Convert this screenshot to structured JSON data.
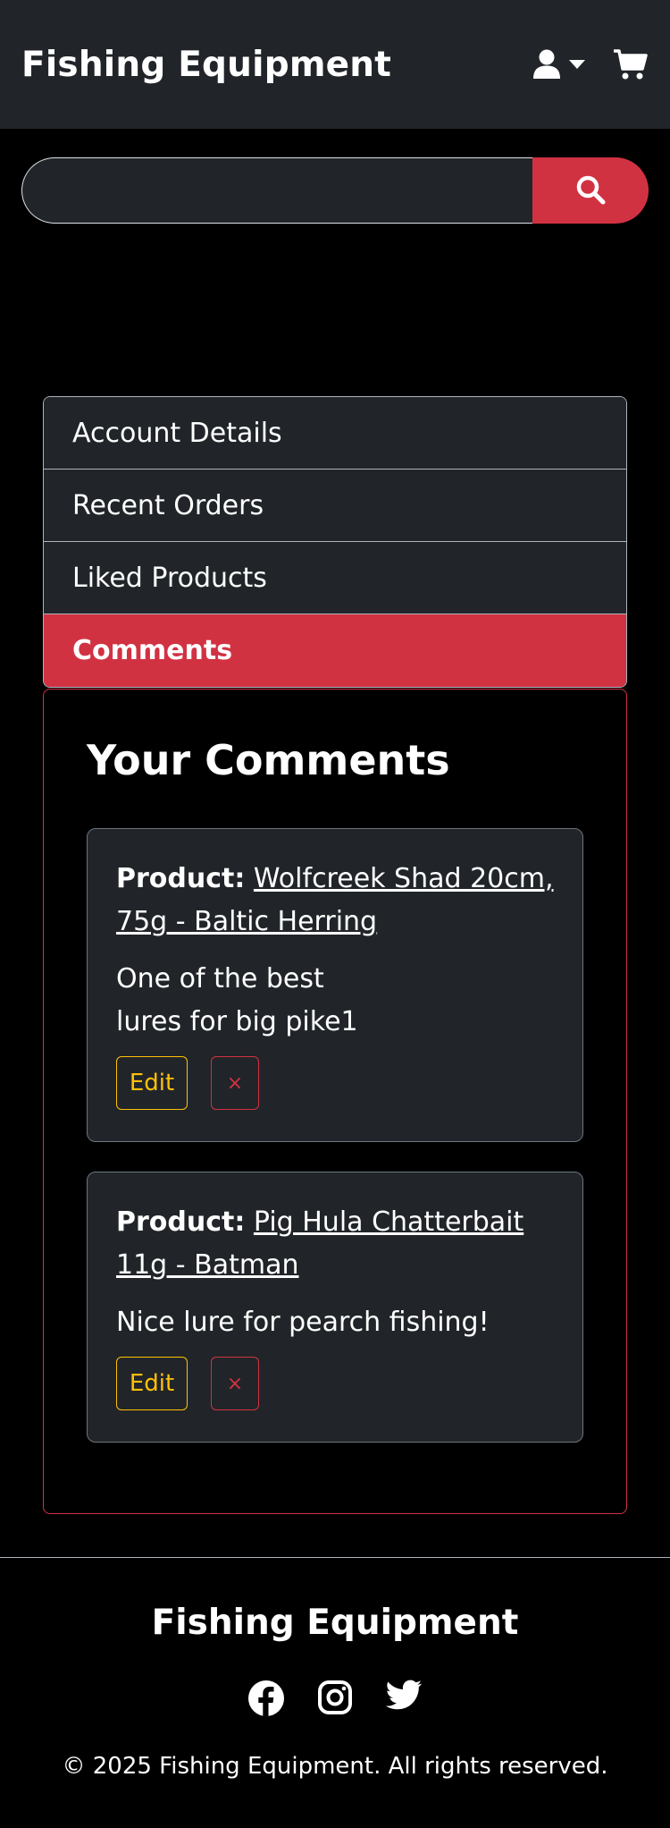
{
  "header": {
    "brand": "Fishing Equipment",
    "icons": [
      "user-icon",
      "caret-down-icon",
      "cart-icon"
    ]
  },
  "search": {
    "placeholder": "",
    "value": "",
    "button_icon": "search-icon"
  },
  "account_nav": {
    "items": [
      {
        "label": "Account Details",
        "active": false
      },
      {
        "label": "Recent Orders",
        "active": false
      },
      {
        "label": "Liked Products",
        "active": false
      },
      {
        "label": "Comments",
        "active": true
      }
    ]
  },
  "comments": {
    "title": "Your Comments",
    "product_prefix": "Product:",
    "edit_label": "Edit",
    "delete_label": "×",
    "items": [
      {
        "product_name": "Wolfcreek Shad 20cm, 75g - Baltic Herring",
        "text": "One of the best\nlures for big pike1"
      },
      {
        "product_name": "Pig Hula Chatterbait 11g - Batman",
        "text": "Nice lure for pearch fishing!"
      }
    ]
  },
  "footer": {
    "title": "Fishing Equipment",
    "social_icons": [
      "facebook-icon",
      "instagram-icon",
      "twitter-icon"
    ],
    "copyright": "© 2025 Fishing Equipment. All rights reserved."
  },
  "colors": {
    "accent": "#d13242",
    "header_bg": "#212529",
    "page_bg": "#000000",
    "warning": "#ffc107"
  }
}
